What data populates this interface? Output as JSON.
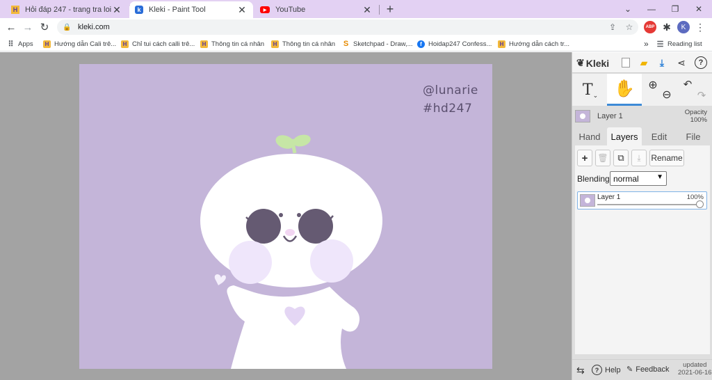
{
  "browser": {
    "tabs": [
      {
        "title": "Hỏi đáp 247 - trang tra loi",
        "favicon": "hoidap-icon",
        "active": false
      },
      {
        "title": "Kleki - Paint Tool",
        "favicon": "kleki-icon",
        "active": true
      },
      {
        "title": "YouTube",
        "favicon": "youtube-icon",
        "active": false
      }
    ],
    "url": "kleki.com",
    "profile_initial": "K",
    "abp_label": "ABP",
    "bookmarks": [
      {
        "label": "Apps",
        "icon": "apps-grid-icon"
      },
      {
        "label": "Hướng dẫn Cali trê...",
        "icon": "hoidap-icon"
      },
      {
        "label": "Chỉ tui cách calli trê...",
        "icon": "hoidap-icon"
      },
      {
        "label": "Thông tin cá nhân",
        "icon": "hoidap-icon"
      },
      {
        "label": "Thông tin cá nhân",
        "icon": "hoidap-icon"
      },
      {
        "label": "Sketchpad - Draw,...",
        "icon": "sketchpad-icon"
      },
      {
        "label": "Hoidap247 Confess...",
        "icon": "facebook-icon"
      },
      {
        "label": "Hướng dẫn cách tr...",
        "icon": "hoidap-icon"
      }
    ],
    "overflow": "»",
    "reading_list": "Reading list"
  },
  "canvas": {
    "background": "#c4b5d9",
    "watermark_line1": "@lunarie",
    "watermark_line2": "#hd247"
  },
  "kleki": {
    "brand": "Kleki",
    "layer_name": "Layer 1",
    "opacity_label": "Opacity",
    "opacity_value": "100%",
    "tabs": [
      "Hand",
      "Layers",
      "Edit",
      "File"
    ],
    "active_tab": "Layers",
    "rename_label": "Rename",
    "blending_label": "Blending",
    "blending_value": "normal",
    "layers": [
      {
        "name": "Layer 1",
        "opacity": "100%",
        "opacity_fraction": 1.0
      }
    ],
    "footer": {
      "help": "Help",
      "feedback": "Feedback",
      "updated_label": "updated",
      "updated_date": "2021-06-16"
    },
    "accent": "#3d8bd7"
  }
}
